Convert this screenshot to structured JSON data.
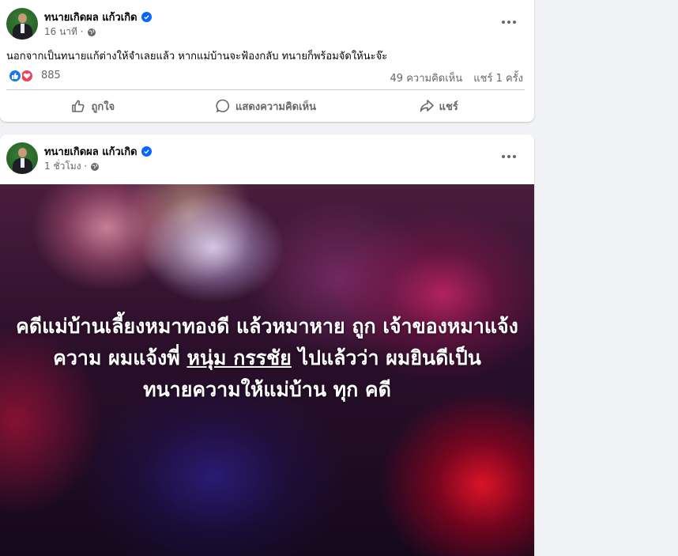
{
  "colors": {
    "background": "#f0f2f5",
    "card": "#ffffff",
    "verified_blue": "#0866ff",
    "like_blue": "#1877f2",
    "love_red": "#f33e58",
    "secondary_text": "#65676b"
  },
  "posts": [
    {
      "author": "ทนายเกิดผล แก้วเกิด",
      "verified_icon": "verified-badge-icon",
      "time": "16 นาที ·",
      "audience_icon": "globe-icon",
      "text": "นอกจากเป็นทนายแก้ต่างให้จำเลยแล้ว หากแม่บ้านจะฟ้องกลับ ทนายก็พร้อมจัดให้นะจ๊ะ",
      "reactions": {
        "icons": [
          "like-icon",
          "love-icon"
        ],
        "count": "885",
        "comments": "49 ความคิดเห็น",
        "shares": "แชร์ 1 ครั้ง"
      },
      "actions": [
        {
          "icon": "thumbs-up-icon",
          "label": "ถูกใจ"
        },
        {
          "icon": "comment-icon",
          "label": "แสดงความคิดเห็น"
        },
        {
          "icon": "share-icon",
          "label": "แชร์"
        }
      ]
    },
    {
      "author": "ทนายเกิดผล แก้วเกิด",
      "verified_icon": "verified-badge-icon",
      "time": "1 ชั่วโมง ·",
      "audience_icon": "globe-icon",
      "image_text": {
        "before_mention": "คดีแม่บ้านเลี้ยงหมาทองดี แล้วหมาหาย ถูก เจ้าของหมาแจ้งความ ผมแจ้งพี่ ",
        "mention": "หนุ่ม กรรชัย",
        "after_mention": " ไปแล้วว่า ผมยินดีเป็นทนายความให้แม่บ้าน ทุก คดี"
      }
    }
  ]
}
